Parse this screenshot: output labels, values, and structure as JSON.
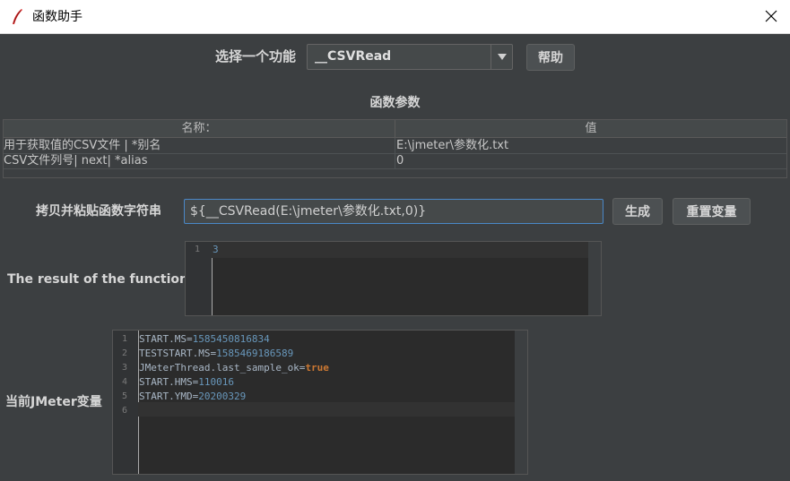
{
  "window": {
    "title": "函数助手"
  },
  "top": {
    "select_label": "选择一个功能",
    "selected_function": "__CSVRead",
    "help_label": "帮助"
  },
  "params": {
    "title": "函数参数",
    "columns": [
      "名称：",
      "值"
    ],
    "rows": [
      {
        "name": "用于获取值的CSV文件 | *别名",
        "value": "E:\\jmeter\\参数化.txt"
      },
      {
        "name": "CSV文件列号| next| *alias",
        "value": "0"
      }
    ]
  },
  "copy": {
    "label": "拷贝并粘贴函数字符串",
    "function_string": "${__CSVRead(E:\\jmeter\\参数化.txt,0)}",
    "generate_label": "生成",
    "reset_label": "重置变量"
  },
  "result": {
    "label": "The result of the function is",
    "line_numbers": [
      "1"
    ],
    "lines": [
      "3"
    ]
  },
  "variables": {
    "label": "当前JMeter变量",
    "line_numbers": [
      "1",
      "2",
      "3",
      "4",
      "5",
      "6"
    ],
    "lines": [
      {
        "key": "START.MS=",
        "value": "1585450816834",
        "value_type": "num"
      },
      {
        "key": "TESTSTART.MS=",
        "value": "1585469186589",
        "value_type": "num"
      },
      {
        "key": "JMeterThread.last_sample_ok=",
        "value": "true",
        "value_type": "kw"
      },
      {
        "key": "START.HMS=",
        "value": "110016",
        "value_type": "num"
      },
      {
        "key": "START.YMD=",
        "value": "20200329",
        "value_type": "num"
      },
      {
        "key": "",
        "value": "",
        "value_type": "num"
      }
    ]
  },
  "colors": {
    "background": "#3c3f41",
    "editor_bg": "#2b2b2b",
    "number": "#6897bb",
    "keyword": "#cc7832",
    "focus_border": "#4a88c7"
  }
}
